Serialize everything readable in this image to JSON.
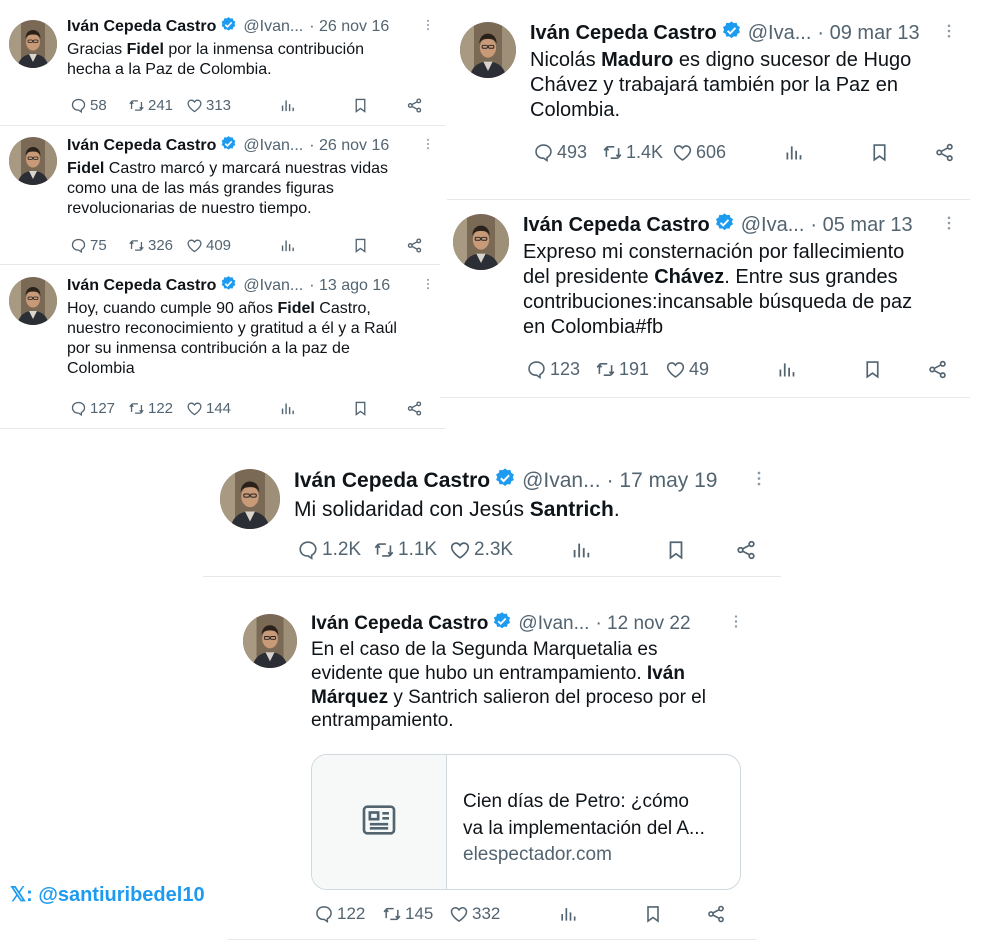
{
  "tweets": [
    {
      "name": "Iván Cepeda Castro",
      "handle": "@Ivan...",
      "date": "· 26 nov 16",
      "text_html": "Gracias <b>Fidel</b> por la inmensa contribución<br>hecha a la Paz de Colombia.",
      "replies": "58",
      "retweets": "241",
      "likes": "313"
    },
    {
      "name": "Iván Cepeda Castro",
      "handle": "@Ivan...",
      "date": "· 26 nov 16",
      "text_html": "<b>Fidel</b> Castro marcó y marcará nuestras vidas<br>como una de las más grandes figuras<br>revolucionarias de nuestro tiempo.",
      "replies": "75",
      "retweets": "326",
      "likes": "409"
    },
    {
      "name": "Iván Cepeda Castro",
      "handle": "@Ivan...",
      "date": "· 13 ago 16",
      "text_html": "Hoy, cuando cumple 90 años <b>Fidel</b> Castro,<br>nuestro reconocimiento y gratitud a él y a Raúl<br>por su inmensa contribución a la paz de<br>Colombia",
      "replies": "127",
      "retweets": "122",
      "likes": "144"
    },
    {
      "name": "Iván Cepeda Castro",
      "handle": "@Iva...",
      "date": "· 09 mar 13",
      "text_html": "Nicolás <b>Maduro</b> es digno sucesor de Hugo<br>Chávez y trabajará también por la Paz en<br>Colombia.",
      "replies": "493",
      "retweets": "1.4K",
      "likes": "606"
    },
    {
      "name": "Iván Cepeda Castro",
      "handle": "@Iva...",
      "date": "· 05 mar 13",
      "text_html": "Expreso mi consternación por fallecimiento<br>del presidente <b>Chávez</b>. Entre sus grandes<br>contribuciones:incansable búsqueda de paz<br>en Colombia#fb",
      "replies": "123",
      "retweets": "191",
      "likes": "49"
    },
    {
      "name": "Iván Cepeda Castro",
      "handle": "@Ivan...",
      "date": "· 17 may 19",
      "text_html": "Mi solidaridad con Jesús <b>Santrich</b>.",
      "replies": "1.2K",
      "retweets": "1.1K",
      "likes": "2.3K"
    },
    {
      "name": "Iván Cepeda Castro",
      "handle": "@Ivan...",
      "date": "· 12 nov 22",
      "text_html": "En el caso de la Segunda Marquetalia es<br>evidente que hubo un entrampamiento. <b>Iván</b><br><b>Márquez</b> y Santrich salieron del proceso por el<br>entrampamiento.",
      "replies": "122",
      "retweets": "145",
      "likes": "332",
      "card": {
        "title_line1": "Cien días de Petro: ¿cómo",
        "title_line2": "va la implementación del A...",
        "domain": "elespectador.com"
      }
    }
  ],
  "watermark": {
    "x_glyph": "𝕏",
    "handle": ": @santiuribedel10"
  },
  "colors": {
    "verified": "#1d9bf0",
    "meta": "#536471",
    "watermark": "#1d9bf0"
  }
}
